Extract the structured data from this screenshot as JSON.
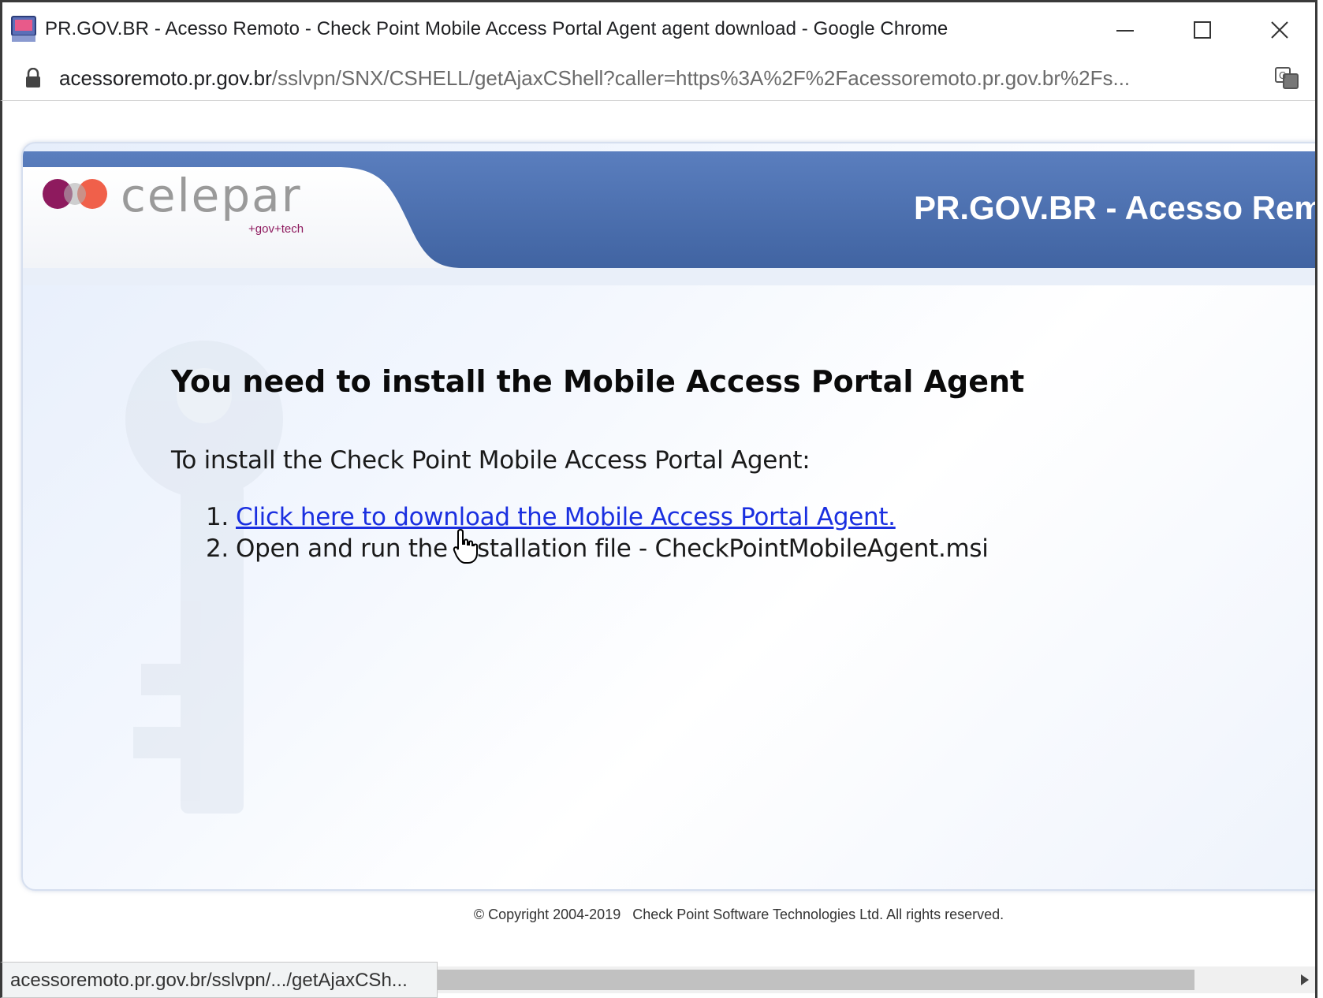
{
  "window": {
    "title": "PR.GOV.BR - Acesso Remoto - Check Point Mobile Access Portal Agent agent download - Google Chrome",
    "icons": {
      "app": "portal-app-icon",
      "minimize": "minimize-icon",
      "maximize": "maximize-icon",
      "close": "close-icon"
    }
  },
  "address": {
    "host": "acessoremoto.pr.gov.br",
    "path": "/sslvpn/SNX/CSHELL/getAjaxCShell?caller=https%3A%2F%2Facessoremoto.pr.gov.br%2Fs...",
    "icons": {
      "lock": "lock-icon",
      "translate": "translate-icon"
    }
  },
  "banner": {
    "logo_text": "celepar",
    "logo_tagline": "+gov+tech",
    "title": "PR.GOV.BR - Acesso Rem"
  },
  "main": {
    "heading": "You need to install the Mobile Access Portal Agent",
    "intro": "To install the Check Point Mobile Access Portal Agent:",
    "steps": [
      {
        "number": "1.",
        "text": "Click here to download the Mobile Access Portal Agent."
      },
      {
        "number": "2.",
        "text": "Open and run the installation file - CheckPointMobileAgent.msi"
      }
    ]
  },
  "footer": {
    "copyright": "© Copyright 2004-2019",
    "company": "Check Point Software Technologies Ltd. All rights reserved."
  },
  "status": {
    "url": "acessoremoto.pr.gov.br/sslvpn/.../getAjaxCSh..."
  },
  "colors": {
    "banner_blue": "#4a6fae",
    "link": "#1a2fe0",
    "logo_purple": "#8e1a5e",
    "logo_orange": "#f0604a"
  }
}
